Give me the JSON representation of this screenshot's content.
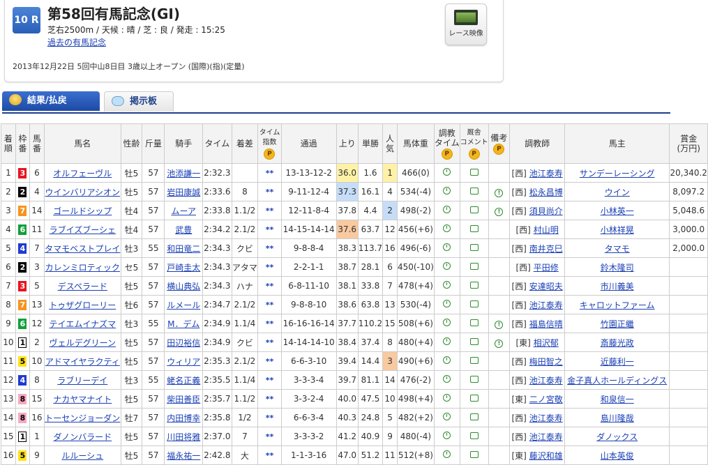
{
  "race": {
    "number": "10 R",
    "title": "第58回有馬記念(GI)",
    "conditions": "芝右2500m / 天候 : 晴 / 芝 : 良 / 発走 : 15:25",
    "past_link": "過去の有馬記念",
    "date_info": "2013年12月22日  5回中山8日目  3歳以上オープン  (国際)(指)(定量)",
    "video_label": "レース映像"
  },
  "tabs": {
    "results": "結果/払戻",
    "board": "掲示板"
  },
  "columns": {
    "rank": "着\n順",
    "waku": "枠\n番",
    "uma": "馬\n番",
    "name": "馬名",
    "sexage": "性齢",
    "weight": "斤量",
    "jockey": "騎手",
    "time": "タイム",
    "margin": "着差",
    "timeindex": "タイム\n指数",
    "passing": "通過",
    "last3f": "上り",
    "odds": "単勝",
    "pop": "人\n気",
    "bodyweight": "馬体重",
    "train_time": "調教\nタイム",
    "stable_comment": "厩舎\nコメント",
    "remarks": "備考",
    "trainer": "調教師",
    "owner": "馬主",
    "prize": "賞金\n(万円)"
  },
  "premium_mark": "P",
  "rows": [
    {
      "rank": "1",
      "waku": "3",
      "uma": "6",
      "name": "オルフェーヴル",
      "sexage": "牡5",
      "weight": "57",
      "jockey": "池添謙一",
      "time": "2:32.3",
      "margin": "",
      "ti": "**",
      "passing": "13-13-12-2",
      "last3f": "36.0",
      "hl3f": "hi1",
      "odds": "1.6",
      "pop": "1",
      "hlpop": "hi1",
      "bw": "466(0)",
      "remark": false,
      "dir": "[西]",
      "trainer": "池江泰寿",
      "owner": "サンデーレーシング",
      "prize": "20,340.2"
    },
    {
      "rank": "2",
      "waku": "2",
      "uma": "4",
      "name": "ウインバリアシオン",
      "sexage": "牡5",
      "weight": "57",
      "jockey": "岩田康誠",
      "time": "2:33.6",
      "margin": "8",
      "ti": "**",
      "passing": "9-11-12-4",
      "last3f": "37.3",
      "hl3f": "hi2",
      "odds": "16.1",
      "pop": "4",
      "hlpop": "",
      "bw": "534(-4)",
      "remark": true,
      "dir": "[西]",
      "trainer": "松永昌博",
      "owner": "ウイン",
      "prize": "8,097.2"
    },
    {
      "rank": "3",
      "waku": "7",
      "uma": "14",
      "name": "ゴールドシップ",
      "sexage": "牡4",
      "weight": "57",
      "jockey": "ムーア",
      "time": "2:33.8",
      "margin": "1.1/2",
      "ti": "**",
      "passing": "12-11-8-4",
      "last3f": "37.8",
      "hl3f": "",
      "odds": "4.4",
      "pop": "2",
      "hlpop": "hi2",
      "bw": "498(-2)",
      "remark": true,
      "dir": "[西]",
      "trainer": "須貝尚介",
      "owner": "小林英一",
      "prize": "5,048.6"
    },
    {
      "rank": "4",
      "waku": "6",
      "uma": "11",
      "name": "ラブイズブーシェ",
      "sexage": "牡4",
      "weight": "57",
      "jockey": "武豊",
      "time": "2:34.2",
      "margin": "2.1/2",
      "ti": "**",
      "passing": "14-15-14-14",
      "last3f": "37.6",
      "hl3f": "hi3",
      "odds": "63.7",
      "pop": "12",
      "hlpop": "",
      "bw": "456(+6)",
      "remark": false,
      "dir": "[西]",
      "trainer": "村山明",
      "owner": "小林祥晃",
      "prize": "3,000.0"
    },
    {
      "rank": "5",
      "waku": "4",
      "uma": "7",
      "name": "タマモベストプレイ",
      "sexage": "牡3",
      "weight": "55",
      "jockey": "和田竜二",
      "time": "2:34.3",
      "margin": "クビ",
      "ti": "**",
      "passing": "9-8-8-4",
      "last3f": "38.3",
      "hl3f": "",
      "odds": "113.7",
      "pop": "16",
      "hlpop": "",
      "bw": "496(-6)",
      "remark": false,
      "dir": "[西]",
      "trainer": "南井克巳",
      "owner": "タマモ",
      "prize": "2,000.0"
    },
    {
      "rank": "6",
      "waku": "2",
      "uma": "3",
      "name": "カレンミロティック",
      "sexage": "セ5",
      "weight": "57",
      "jockey": "戸崎圭太",
      "time": "2:34.3",
      "margin": "アタマ",
      "ti": "**",
      "passing": "2-2-1-1",
      "last3f": "38.7",
      "hl3f": "",
      "odds": "28.1",
      "pop": "6",
      "hlpop": "",
      "bw": "450(-10)",
      "remark": false,
      "dir": "[西]",
      "trainer": "平田修",
      "owner": "鈴木隆司",
      "prize": ""
    },
    {
      "rank": "7",
      "waku": "3",
      "uma": "5",
      "name": "デスペラード",
      "sexage": "牡5",
      "weight": "57",
      "jockey": "横山典弘",
      "time": "2:34.3",
      "margin": "ハナ",
      "ti": "**",
      "passing": "6-8-11-10",
      "last3f": "38.1",
      "hl3f": "",
      "odds": "33.8",
      "pop": "7",
      "hlpop": "",
      "bw": "478(+4)",
      "remark": false,
      "dir": "[西]",
      "trainer": "安達昭夫",
      "owner": "市川義美",
      "prize": ""
    },
    {
      "rank": "8",
      "waku": "7",
      "uma": "13",
      "name": "トゥザグローリー",
      "sexage": "牡6",
      "weight": "57",
      "jockey": "ルメール",
      "time": "2:34.7",
      "margin": "2.1/2",
      "ti": "**",
      "passing": "9-8-8-10",
      "last3f": "38.6",
      "hl3f": "",
      "odds": "63.8",
      "pop": "13",
      "hlpop": "",
      "bw": "530(-4)",
      "remark": false,
      "dir": "[西]",
      "trainer": "池江泰寿",
      "owner": "キャロットファーム",
      "prize": ""
    },
    {
      "rank": "9",
      "waku": "6",
      "uma": "12",
      "name": "テイエムイナズマ",
      "sexage": "牡3",
      "weight": "55",
      "jockey": "M．デム",
      "time": "2:34.9",
      "margin": "1.1/4",
      "ti": "**",
      "passing": "16-16-16-14",
      "last3f": "37.7",
      "hl3f": "",
      "odds": "110.2",
      "pop": "15",
      "hlpop": "",
      "bw": "508(+6)",
      "remark": true,
      "dir": "[西]",
      "trainer": "福島信晴",
      "owner": "竹園正繼",
      "prize": ""
    },
    {
      "rank": "10",
      "waku": "1",
      "uma": "2",
      "name": "ヴェルデグリーン",
      "sexage": "牡5",
      "weight": "57",
      "jockey": "田辺裕信",
      "time": "2:34.9",
      "margin": "クビ",
      "ti": "**",
      "passing": "14-14-14-10",
      "last3f": "38.4",
      "hl3f": "",
      "odds": "37.4",
      "pop": "8",
      "hlpop": "",
      "bw": "480(+4)",
      "remark": true,
      "dir": "[東]",
      "trainer": "相沢郁",
      "owner": "斎藤光政",
      "prize": ""
    },
    {
      "rank": "11",
      "waku": "5",
      "uma": "10",
      "name": "アドマイヤラクティ",
      "sexage": "牡5",
      "weight": "57",
      "jockey": "ウィリア",
      "time": "2:35.3",
      "margin": "2.1/2",
      "ti": "**",
      "passing": "6-6-3-10",
      "last3f": "39.4",
      "hl3f": "",
      "odds": "14.4",
      "pop": "3",
      "hlpop": "hi3",
      "bw": "490(+6)",
      "remark": false,
      "dir": "[西]",
      "trainer": "梅田智之",
      "owner": "近藤利一",
      "prize": ""
    },
    {
      "rank": "12",
      "waku": "4",
      "uma": "8",
      "name": "ラブリーデイ",
      "sexage": "牡3",
      "weight": "55",
      "jockey": "蛯名正義",
      "time": "2:35.5",
      "margin": "1.1/4",
      "ti": "**",
      "passing": "3-3-3-4",
      "last3f": "39.7",
      "hl3f": "",
      "odds": "81.1",
      "pop": "14",
      "hlpop": "",
      "bw": "476(-2)",
      "remark": false,
      "dir": "[西]",
      "trainer": "池江泰寿",
      "owner": "金子真人ホールディングス",
      "prize": ""
    },
    {
      "rank": "13",
      "waku": "8",
      "uma": "15",
      "name": "ナカヤマナイト",
      "sexage": "牡5",
      "weight": "57",
      "jockey": "柴田善臣",
      "time": "2:35.7",
      "margin": "1.1/2",
      "ti": "**",
      "passing": "3-3-2-4",
      "last3f": "40.0",
      "hl3f": "",
      "odds": "47.5",
      "pop": "10",
      "hlpop": "",
      "bw": "498(+4)",
      "remark": false,
      "dir": "[東]",
      "trainer": "二ノ宮敬",
      "owner": "和泉信一",
      "prize": ""
    },
    {
      "rank": "14",
      "waku": "8",
      "uma": "16",
      "name": "トーセンジョーダン",
      "sexage": "牡7",
      "weight": "57",
      "jockey": "内田博幸",
      "time": "2:35.8",
      "margin": "1/2",
      "ti": "**",
      "passing": "6-6-3-4",
      "last3f": "40.3",
      "hl3f": "",
      "odds": "24.8",
      "pop": "5",
      "hlpop": "",
      "bw": "482(+2)",
      "remark": false,
      "dir": "[西]",
      "trainer": "池江泰寿",
      "owner": "島川隆哉",
      "prize": ""
    },
    {
      "rank": "15",
      "waku": "1",
      "uma": "1",
      "name": "ダノンバラード",
      "sexage": "牡5",
      "weight": "57",
      "jockey": "川田将雅",
      "time": "2:37.0",
      "margin": "7",
      "ti": "**",
      "passing": "3-3-3-2",
      "last3f": "41.2",
      "hl3f": "",
      "odds": "40.9",
      "pop": "9",
      "hlpop": "",
      "bw": "480(-4)",
      "remark": false,
      "dir": "[西]",
      "trainer": "池江泰寿",
      "owner": "ダノックス",
      "prize": ""
    },
    {
      "rank": "16",
      "waku": "5",
      "uma": "9",
      "name": "ルルーシュ",
      "sexage": "牡5",
      "weight": "57",
      "jockey": "福永祐一",
      "time": "2:42.8",
      "margin": "大",
      "ti": "**",
      "passing": "1-1-3-16",
      "last3f": "47.0",
      "hl3f": "",
      "odds": "51.2",
      "pop": "11",
      "hlpop": "",
      "bw": "512(+8)",
      "remark": false,
      "dir": "[東]",
      "trainer": "藤沢和雄",
      "owner": "山本英俊",
      "prize": ""
    }
  ]
}
